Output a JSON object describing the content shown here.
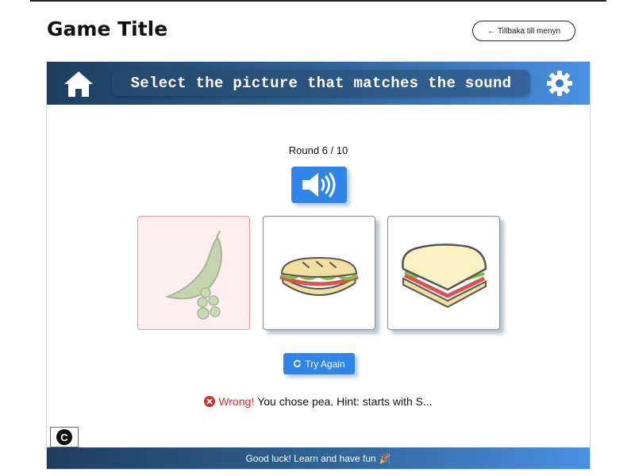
{
  "page": {
    "title": "Game Title",
    "back_arrow": "←",
    "back_label": "Tillbaka till menyn"
  },
  "header": {
    "instruction": "Select the picture that matches the sound",
    "home_icon": "home-icon",
    "settings_icon": "gear-icon"
  },
  "game": {
    "round_label": "Round 6 / 10",
    "sound_icon": "speaker-icon",
    "choices": [
      {
        "name": "pea",
        "state": "wrong"
      },
      {
        "name": "sub sandwich",
        "state": "default"
      },
      {
        "name": "sandwich",
        "state": "default"
      }
    ],
    "try_again_label": "Try Again",
    "try_again_icon": "refresh-icon",
    "feedback": {
      "wrong_word": "Wrong!",
      "message": "You chose pea. Hint: starts with S...",
      "icon": "error-icon"
    },
    "corner_button_label": "C"
  },
  "footer": {
    "message": "Good luck! Learn and have fun",
    "emoji": "🎉"
  },
  "colors": {
    "accent": "#2f86e8",
    "header_dark": "#1f3e5e",
    "header_light": "#4a90e2",
    "wrong": "#d32f2f",
    "wrong_bg": "#fdeff0"
  }
}
